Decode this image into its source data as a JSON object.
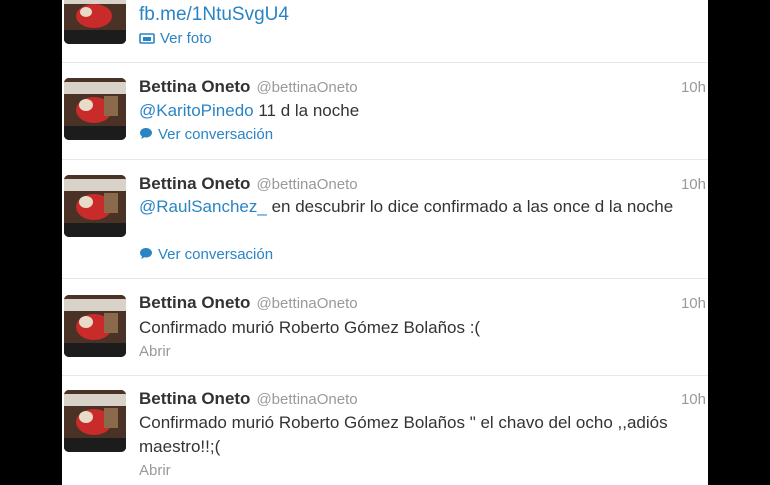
{
  "top_tweet": {
    "link": "fb.me/1NtuSvgU4",
    "action": "Ver foto"
  },
  "tweets": [
    {
      "name": "Bettina Oneto",
      "handle": "@bettinaOneto",
      "time": "10h",
      "mention": "@KaritoPinedo",
      "text": " 11 d la noche",
      "action": "Ver conversación"
    },
    {
      "name": "Bettina Oneto",
      "handle": "@bettinaOneto",
      "time": "10h",
      "mention": "@RaulSanchez_",
      "text": " en descubrir lo dice confirmado a las once d la noche",
      "action": "Ver conversación"
    },
    {
      "name": "Bettina Oneto",
      "handle": "@bettinaOneto",
      "time": "10h",
      "text": "Confirmado murió Roberto Gómez Bolaños :(",
      "action": "Abrir"
    },
    {
      "name": "Bettina Oneto",
      "handle": "@bettinaOneto",
      "time": "10h",
      "text": "Confirmado murió Roberto Gómez Bolaños \" el chavo del ocho ,,adiós maestro!!;(",
      "action": "Abrir"
    }
  ]
}
